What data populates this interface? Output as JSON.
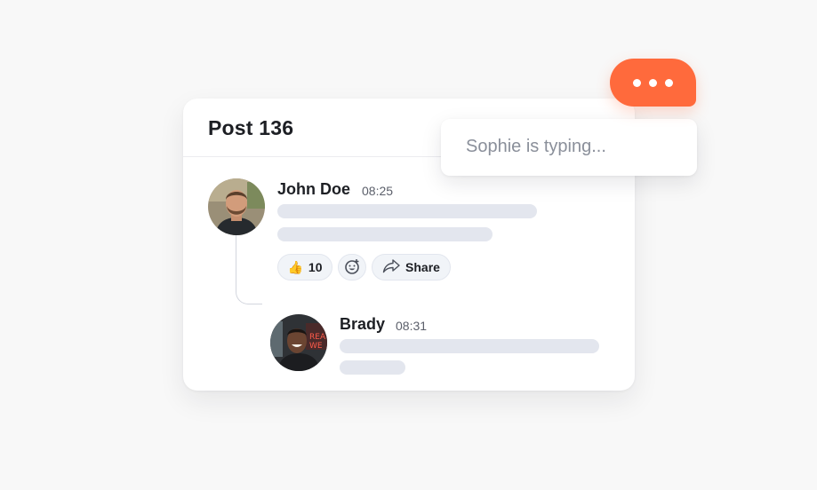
{
  "post": {
    "title": "Post 136"
  },
  "comments": [
    {
      "author": "John Doe",
      "time": "08:25",
      "reactions": {
        "like_emoji": "👍",
        "like_count": "10",
        "share_label": "Share"
      }
    },
    {
      "author": "Brady",
      "time": "08:31"
    }
  ],
  "typing": {
    "text": "Sophie is typing..."
  },
  "colors": {
    "accent": "#ff6a3c",
    "skeleton": "#e3e6ee",
    "chip_bg": "#f1f4f8"
  },
  "icons": [
    "thumbs-up-icon",
    "emoji-add-icon",
    "share-icon",
    "more-dots-icon"
  ]
}
